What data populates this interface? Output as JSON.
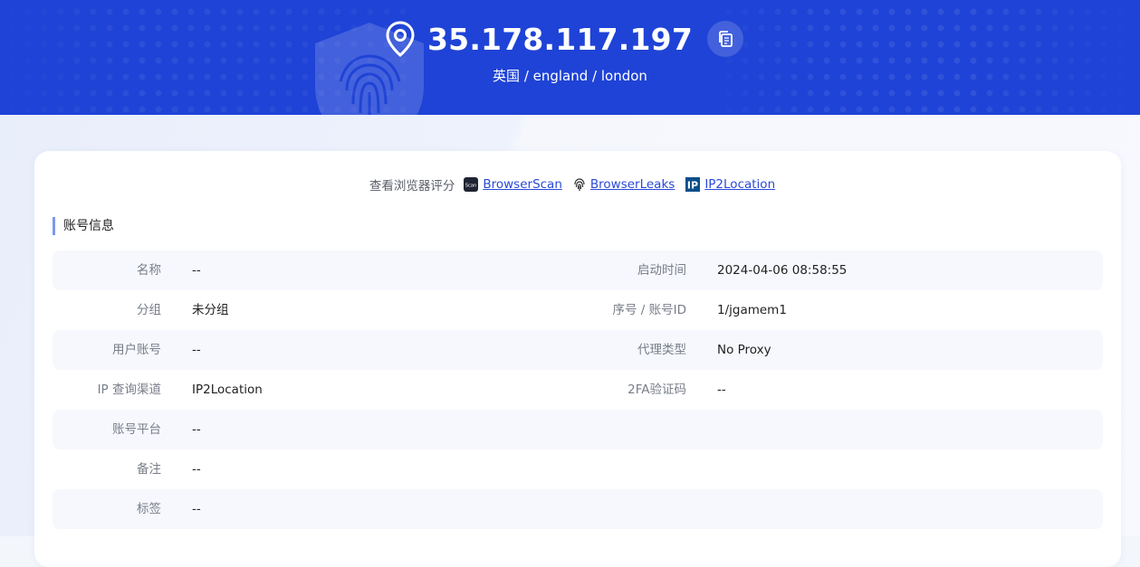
{
  "header": {
    "ip": "35.178.117.197",
    "location": "英国 / england / london"
  },
  "links": {
    "lead": "查看浏览器评分",
    "items": [
      {
        "label": "BrowserScan",
        "icon": "browserscan-icon",
        "icon_text": "Scan"
      },
      {
        "label": "BrowserLeaks",
        "icon": "fingerprint-icon"
      },
      {
        "label": "IP2Location",
        "icon": "ip2location-icon",
        "icon_text": "IP"
      }
    ]
  },
  "section": {
    "title": "账号信息"
  },
  "rows": [
    {
      "label1": "名称",
      "value1": "--",
      "label2": "启动时间",
      "value2": "2024-04-06 08:58:55"
    },
    {
      "label1": "分组",
      "value1": "未分组",
      "label2": "序号 / 账号ID",
      "value2": "1/jgamem1"
    },
    {
      "label1": "用户账号",
      "value1": "--",
      "label2": "代理类型",
      "value2": "No Proxy"
    },
    {
      "label1": "IP 查询渠道",
      "value1": "IP2Location",
      "label2": "2FA验证码",
      "value2": "--"
    },
    {
      "label1": "账号平台",
      "value1": "--"
    },
    {
      "label1": "备注",
      "value1": "--"
    },
    {
      "label1": "标签",
      "value1": "--"
    }
  ],
  "colors": {
    "hero_bg": "#1f43d6",
    "link": "#2a49d8",
    "section_bar": "#7e98ec",
    "row_alt": "#f6f8fd"
  }
}
